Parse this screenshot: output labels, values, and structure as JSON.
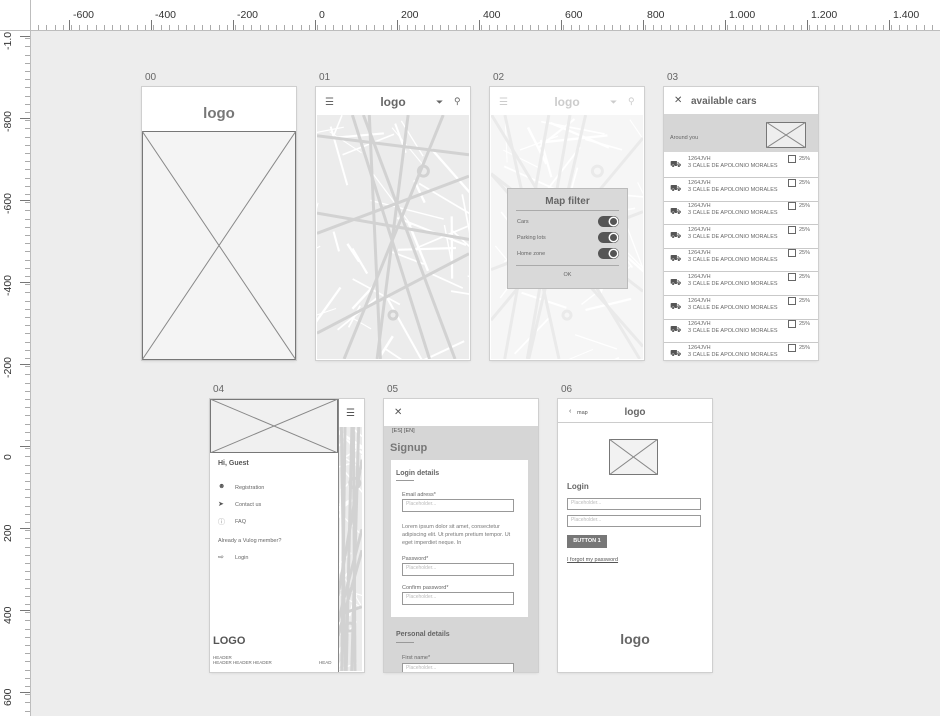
{
  "ruler": {
    "top": [
      "-600",
      "-400",
      "-200",
      "0",
      "200",
      "400",
      "600",
      "800",
      "1.000",
      "1.200",
      "1.400"
    ],
    "left": [
      "-1.0",
      "-800",
      "-600",
      "-400",
      "-200",
      "0",
      "200",
      "400",
      "600"
    ]
  },
  "artboards": [
    "00",
    "01",
    "02",
    "03",
    "04",
    "05",
    "06"
  ],
  "s00": {
    "logo": "logo"
  },
  "s01": {
    "logo": "logo"
  },
  "s02": {
    "logo": "logo",
    "filter_title": "Map filter",
    "filters": [
      "Cars",
      "Parking lots",
      "Home zone"
    ],
    "ok": "OK"
  },
  "s03": {
    "title": "available cars",
    "around": "Around you",
    "cars": [
      {
        "plate": "1264JVH",
        "addr": "3 CALLE DE APOLONIO MORALES",
        "pct": "25%"
      },
      {
        "plate": "1264JVH",
        "addr": "3 CALLE DE APOLONIO MORALES",
        "pct": "25%"
      },
      {
        "plate": "1264JVH",
        "addr": "3 CALLE DE APOLONIO MORALES",
        "pct": "25%"
      },
      {
        "plate": "1264JVH",
        "addr": "3 CALLE DE APOLONIO MORALES",
        "pct": "25%"
      },
      {
        "plate": "1264JVH",
        "addr": "3 CALLE DE APOLONIO MORALES",
        "pct": "25%"
      },
      {
        "plate": "1264JVH",
        "addr": "3 CALLE DE APOLONIO MORALES",
        "pct": "25%"
      },
      {
        "plate": "1264JVH",
        "addr": "3 CALLE DE APOLONIO MORALES",
        "pct": "25%"
      },
      {
        "plate": "1264JVH",
        "addr": "3 CALLE DE APOLONIO MORALES",
        "pct": "25%"
      },
      {
        "plate": "1264JVH",
        "addr": "3 CALLE DE APOLONIO MORALES",
        "pct": "25%"
      }
    ]
  },
  "s04": {
    "greeting": "Hi, Guest",
    "menu": [
      "Registration",
      "Contact us",
      "FAQ"
    ],
    "member": "Already a Vulog member?",
    "login": "Login",
    "logo": "LOGO",
    "header1": "HEADER",
    "header2": "HEADER HEADER HEADER",
    "head": "HEAD"
  },
  "s05": {
    "lang": "[ES] [EN]",
    "title": "Signup",
    "login_details": "Login details",
    "email_label": "Email adress*",
    "placeholder": "Placeholder...",
    "lorem": "Lorem ipsum dolor sit amet, consectetur adipiscing elit. Ut pretium pretium tempor. Ut eget imperdiet neque. In",
    "password_label": "Password*",
    "confirm_label": "Confirm password*",
    "personal_details": "Personal details",
    "first_name": "First name*"
  },
  "s06": {
    "back": "map",
    "logo": "logo",
    "login": "Login",
    "placeholder": "Placeholder...",
    "button": "BUTTON 1",
    "forgot": "I forgot my password",
    "bottom_logo": "logo"
  }
}
